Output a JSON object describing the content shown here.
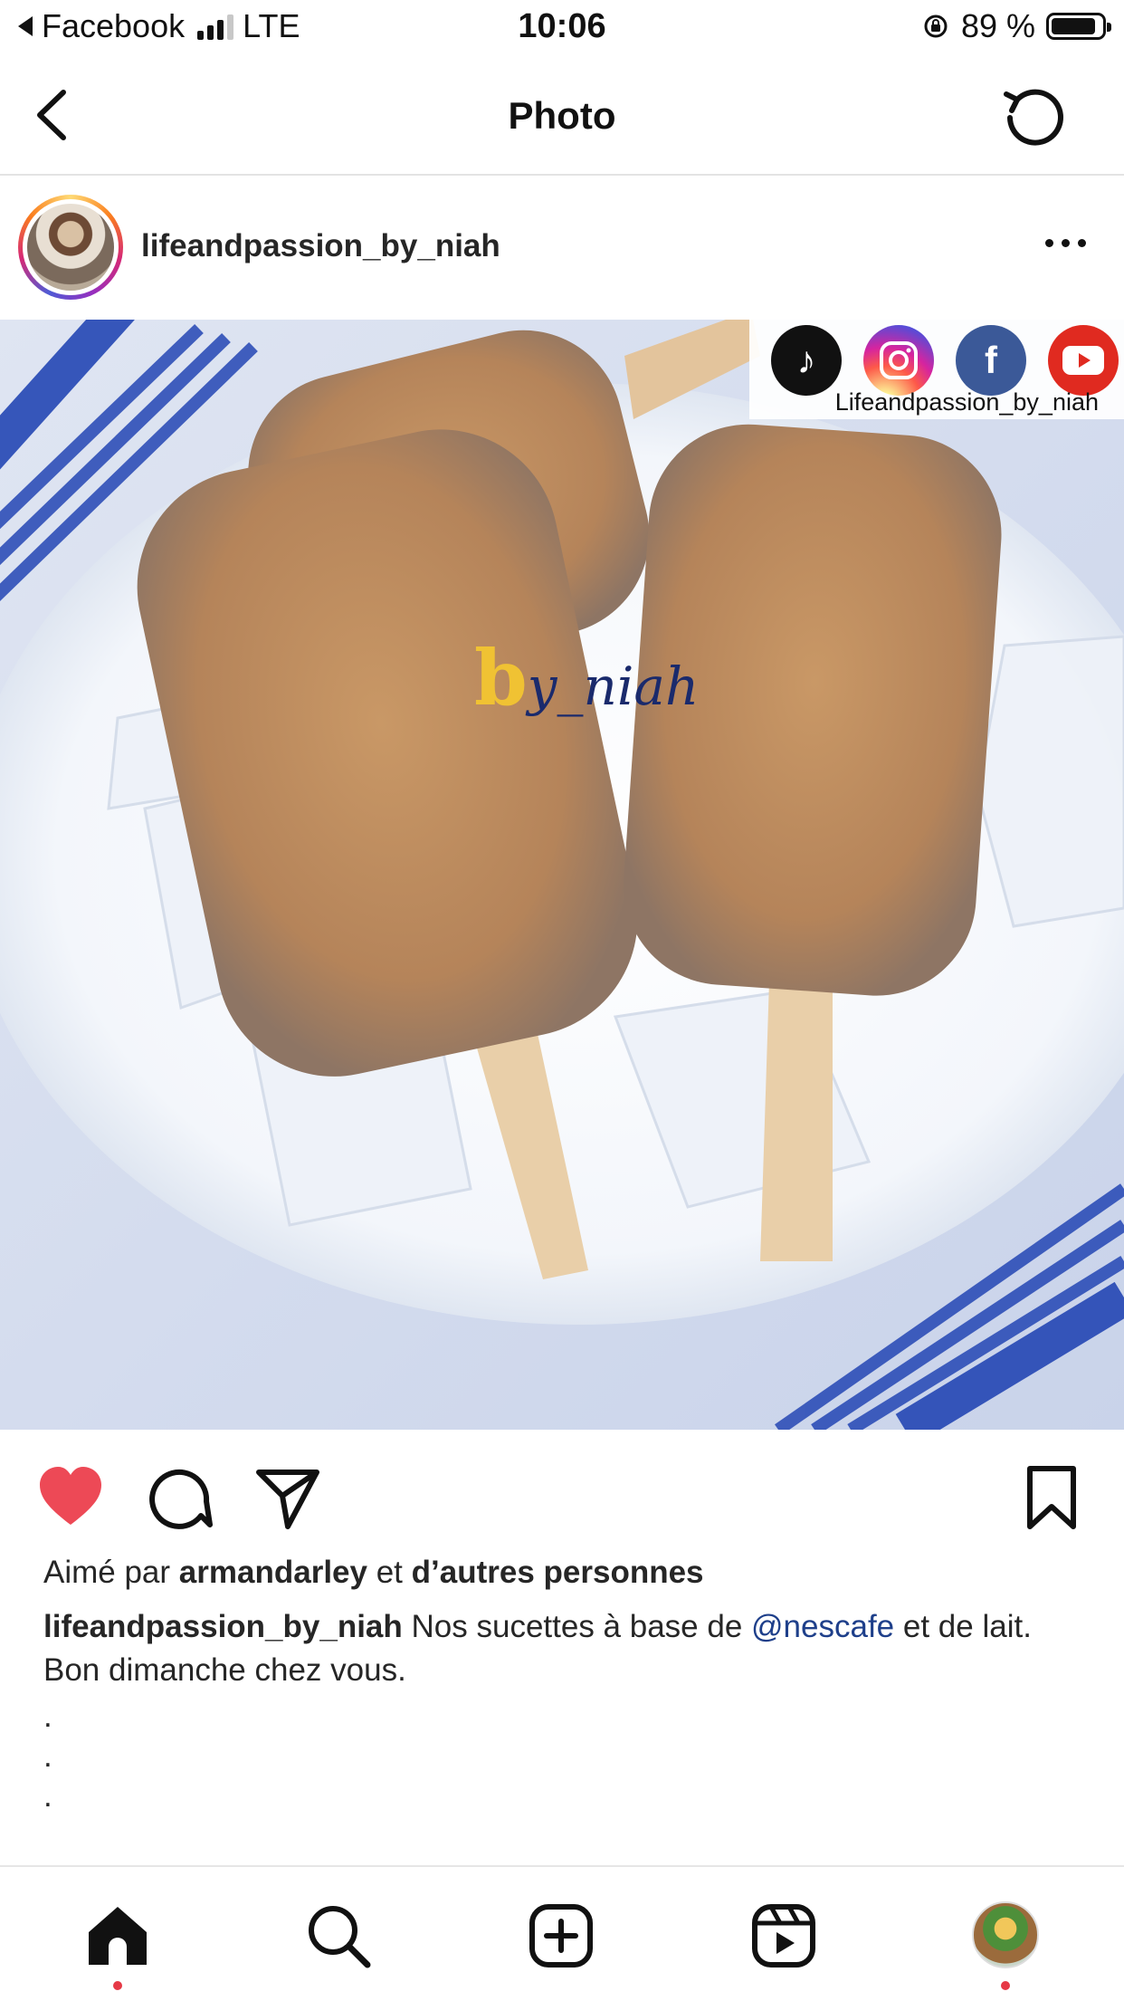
{
  "status_bar": {
    "back_app": "Facebook",
    "network": "LTE",
    "time": "10:06",
    "battery": "89 %",
    "battery_level": 0.89
  },
  "nav": {
    "title": "Photo",
    "back_icon": "chevron-left-icon",
    "refresh_icon": "refresh-icon"
  },
  "post": {
    "username": "lifeandpassion_by_niah",
    "more_icon": "more-horizontal-icon",
    "photo": {
      "social_handle": "Lifeandpassion_by_niah",
      "watermark_b": "b",
      "watermark_text": "y_niah",
      "social_icons": [
        "tiktok-icon",
        "instagram-icon",
        "facebook-icon",
        "youtube-icon"
      ]
    },
    "liked": true,
    "like_color": "#ed4956",
    "liked_by": {
      "prefix": "Aimé par",
      "user": "armandarley",
      "middle": "et",
      "others": "d’autres personnes"
    },
    "caption": {
      "author": "lifeandpassion_by_niah",
      "text_before": "Nos sucettes à base de",
      "mention": "@nescafe",
      "text_after": "et de lait.",
      "line2": "Bon dimanche chez vous.",
      "dots": [
        ".",
        ".",
        "."
      ]
    }
  },
  "tabbar": {
    "items": [
      "home-icon",
      "search-icon",
      "create-icon",
      "reels-icon",
      "profile-avatar"
    ]
  }
}
